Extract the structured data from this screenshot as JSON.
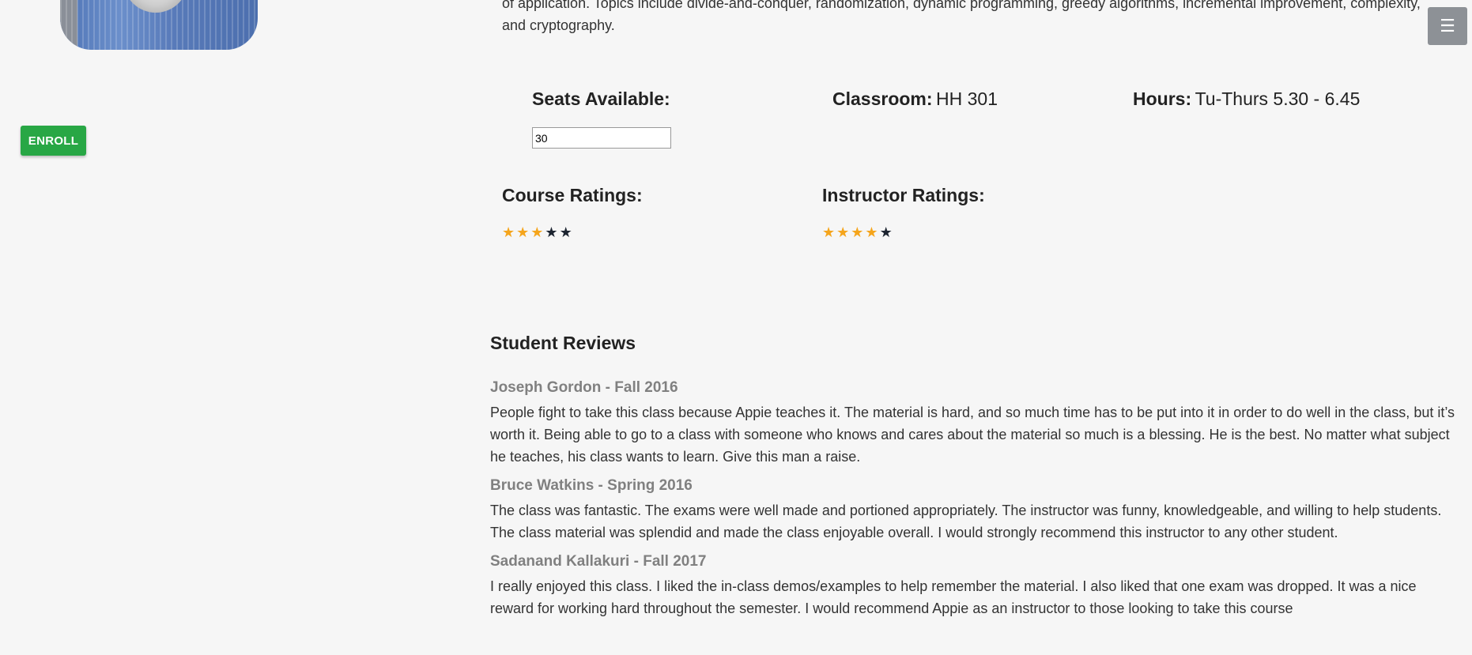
{
  "description": "of application. Topics include divide-and-conquer, randomization, dynamic programming, greedy algorithms, incremental improvement, complexity, and cryptography.",
  "enroll_label": "ENROLL",
  "menu_icon": "hamburger-icon",
  "info": {
    "seats_label": "Seats Available:",
    "seats_value": "30",
    "classroom_label": "Classroom:",
    "classroom_value": "HH 301",
    "hours_label": "Hours:",
    "hours_value": "Tu-Thurs 5.30 - 6.45"
  },
  "ratings": {
    "course_label": "Course Ratings:",
    "course_rating": 3,
    "instructor_label": "Instructor Ratings:",
    "instructor_rating": 4,
    "max": 5,
    "colors": {
      "on": "#f5a51c",
      "off": "#1c2430"
    }
  },
  "reviews_title": "Student Reviews",
  "reviews": [
    {
      "author": "Joseph Gordon - Fall 2016",
      "text": "People fight to take this class because Appie teaches it. The material is hard, and so much time has to be put into it in order to do well in the class, but it’s worth it. Being able to go to a class with someone who knows and cares about the material so much is a blessing. He is the best. No matter what subject he teaches, his class wants to learn. Give this man a raise."
    },
    {
      "author": "Bruce Watkins - Spring 2016",
      "text": "The class was fantastic. The exams were well made and portioned appropriately. The instructor was funny, knowledgeable, and willing to help students. The class material was splendid and made the class enjoyable overall. I would strongly recommend this instructor to any other student."
    },
    {
      "author": "Sadanand Kallakuri - Fall 2017",
      "text": "I really enjoyed this class. I liked the in-class demos/examples to help remember the material. I also liked that one exam was dropped. It was a nice reward for working hard throughout the semester. I would recommend Appie as an instructor to those looking to take this course"
    }
  ],
  "colors": {
    "enroll": "#28a745",
    "menu": "#8d9196",
    "background": "#f6f6f6"
  }
}
